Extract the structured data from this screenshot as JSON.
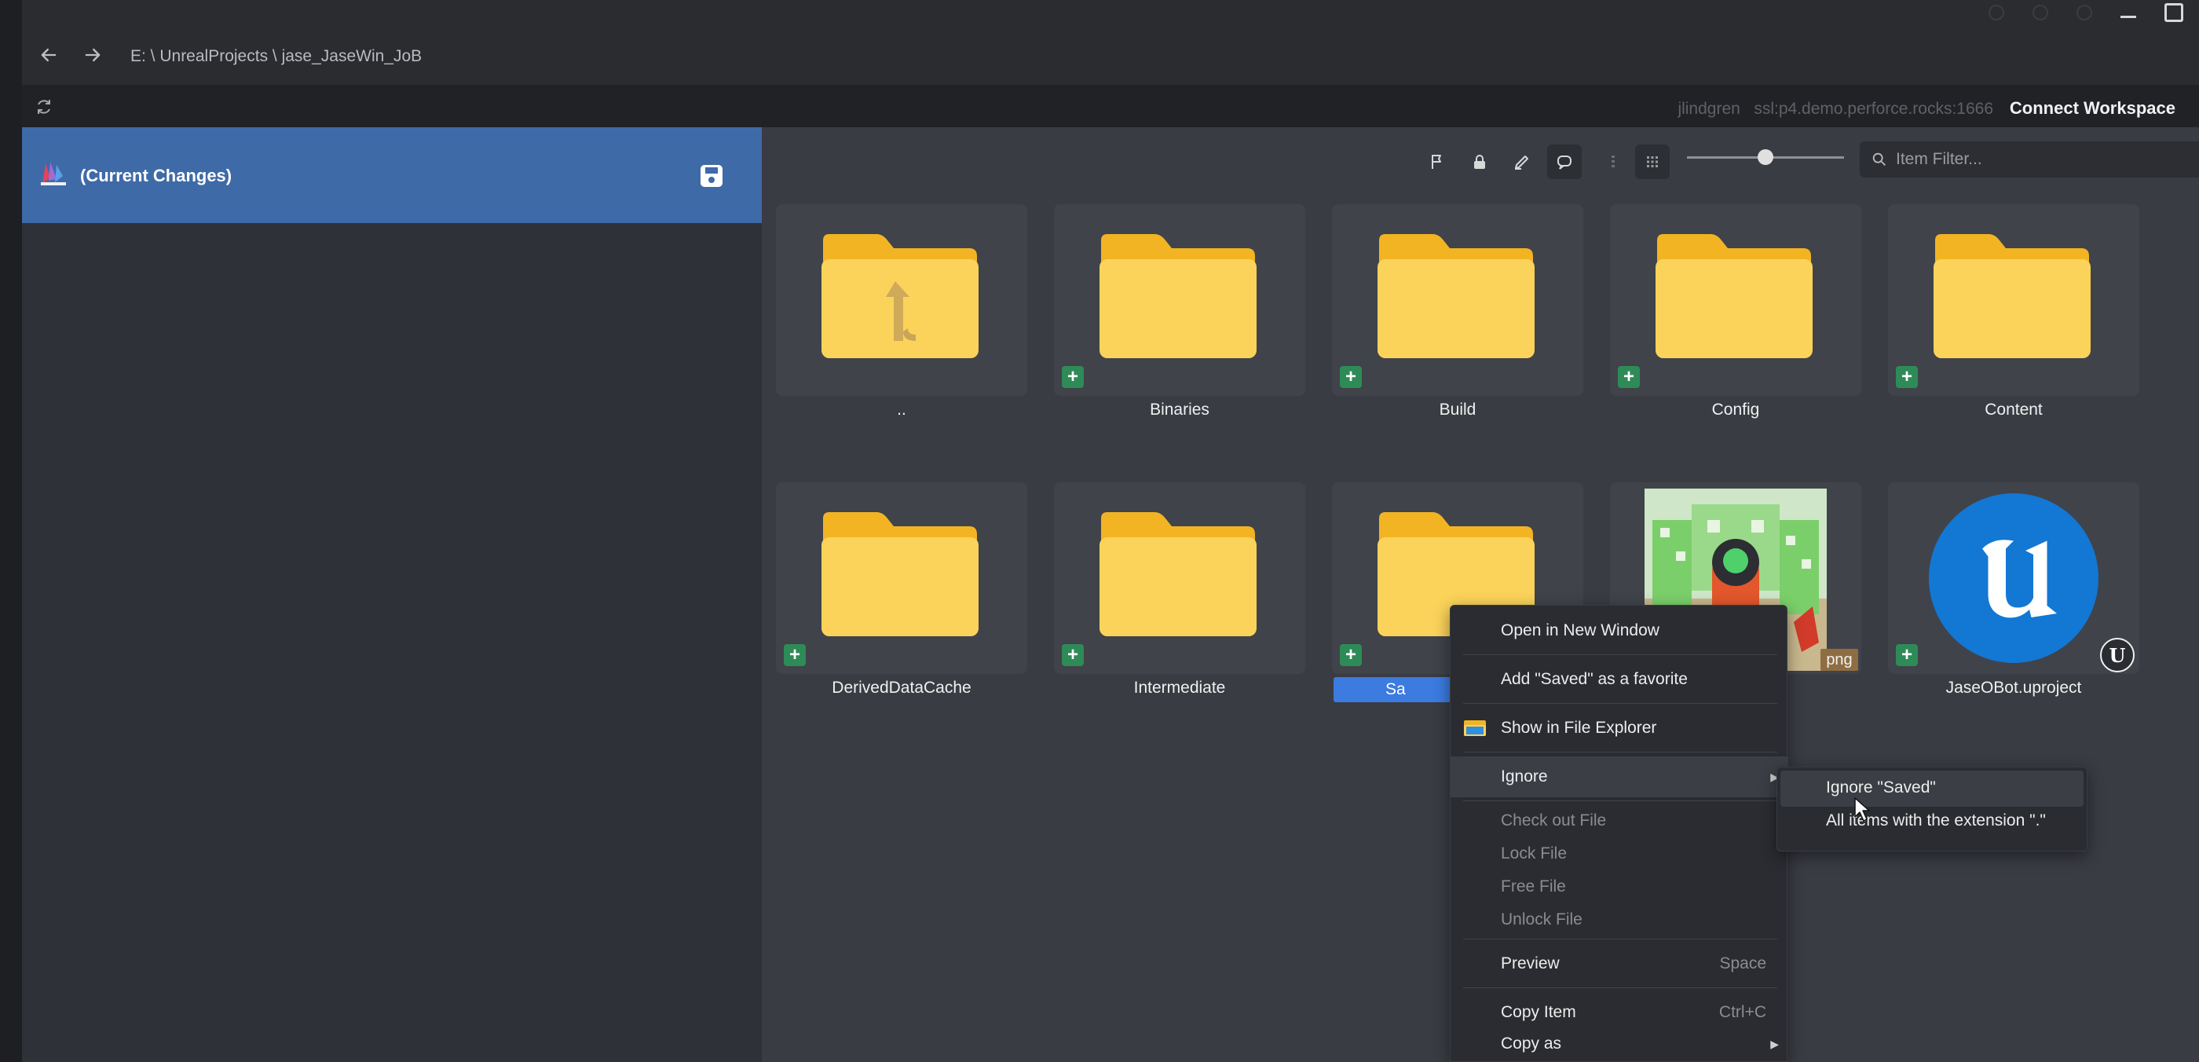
{
  "window": {
    "breadcrumb": "E: \\ UnrealProjects \\ jase_JaseWin_JoB"
  },
  "statusbar": {
    "user": "jlindgren",
    "server": "ssl:p4.demo.perforce.rocks:1666",
    "connect_label": "Connect Workspace"
  },
  "sidebar": {
    "changes_label": "(Current Changes)"
  },
  "toolbar": {
    "filter_placeholder": "Item Filter...",
    "icons": [
      "flag-icon",
      "lock-icon",
      "edit-icon",
      "chat-icon",
      "list-view-icon",
      "grid-view-icon"
    ],
    "zoom_slider_value": 0.55
  },
  "items": [
    {
      "label": "..",
      "type": "parent-folder"
    },
    {
      "label": "Binaries",
      "type": "folder"
    },
    {
      "label": "Build",
      "type": "folder"
    },
    {
      "label": "Config",
      "type": "folder"
    },
    {
      "label": "Content",
      "type": "folder"
    },
    {
      "label": "DerivedDataCache",
      "type": "folder"
    },
    {
      "label": "Intermediate",
      "type": "folder"
    },
    {
      "label": "Saved",
      "type": "folder",
      "visible_label": "Sa"
    },
    {
      "label": "",
      "type": "image",
      "badge": "png"
    },
    {
      "label": "JaseOBot.uproject",
      "type": "uproject"
    }
  ],
  "context_menu": {
    "items": [
      {
        "label": "Open in New Window"
      },
      {
        "label": "Add \"Saved\" as a favorite"
      },
      {
        "label": "Show in File Explorer"
      },
      {
        "label": "Ignore"
      },
      {
        "label": "Check out File"
      },
      {
        "label": "Lock File"
      },
      {
        "label": "Free File"
      },
      {
        "label": "Unlock File"
      },
      {
        "label": "Preview",
        "shortcut": "Space"
      },
      {
        "label": "Copy Item",
        "shortcut": "Ctrl+C"
      },
      {
        "label": "Copy as"
      }
    ],
    "submenu": [
      {
        "label": "Ignore \"Saved\""
      },
      {
        "label": "All items with the extension \".\""
      }
    ]
  },
  "colors": {
    "accent_blue": "#3f6aa8",
    "selection_blue": "#3c7be0",
    "folder_yellow": "#f9c93b",
    "add_badge_green": "#2e8b57",
    "unreal_blue": "#1377d4"
  }
}
